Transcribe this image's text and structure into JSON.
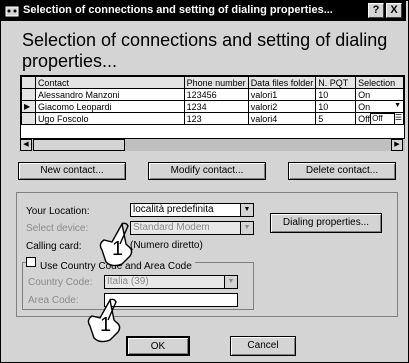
{
  "window": {
    "title": "Selection of connections and setting of dialing properties...",
    "help_button": "?",
    "close_button": "X"
  },
  "heading": "Selection of connections and setting of dialing properties...",
  "grid": {
    "columns": [
      "Contact",
      "Phone number",
      "Data files folder",
      "N. PQT",
      "Selection"
    ],
    "rows": [
      {
        "contact": "Alessandro Manzoni",
        "phone": "123456",
        "folder": "valori1",
        "npqt": "10",
        "selection": "On"
      },
      {
        "contact": "Giacomo Leopardi",
        "phone": "1234",
        "folder": "valori2",
        "npqt": "10",
        "selection": "On"
      },
      {
        "contact": "Ugo Foscolo",
        "phone": "123",
        "folder": "valori4",
        "npqt": "5",
        "selection": "Off",
        "editor_value": "Off"
      }
    ],
    "current_row_marker": "▶"
  },
  "buttons": {
    "new_contact": "New contact...",
    "modify_contact": "Modify contact...",
    "delete_contact": "Delete contact...",
    "dialing_properties": "Dialing properties...",
    "ok": "OK",
    "cancel": "Cancel"
  },
  "location": {
    "label": "Your Location:",
    "value": "località predefinita"
  },
  "device": {
    "label": "Select device:",
    "value": "Standard Modem"
  },
  "calling_card": {
    "label": "Calling card:",
    "value": "(Numero diretto)"
  },
  "country_area": {
    "checkbox_label": "Use Country Code and Area Code",
    "checked": false,
    "country_label": "Country Code:",
    "country_value": "Italia (39)",
    "area_label": "Area Code:",
    "area_value": ""
  },
  "callouts": [
    "1",
    "1"
  ]
}
